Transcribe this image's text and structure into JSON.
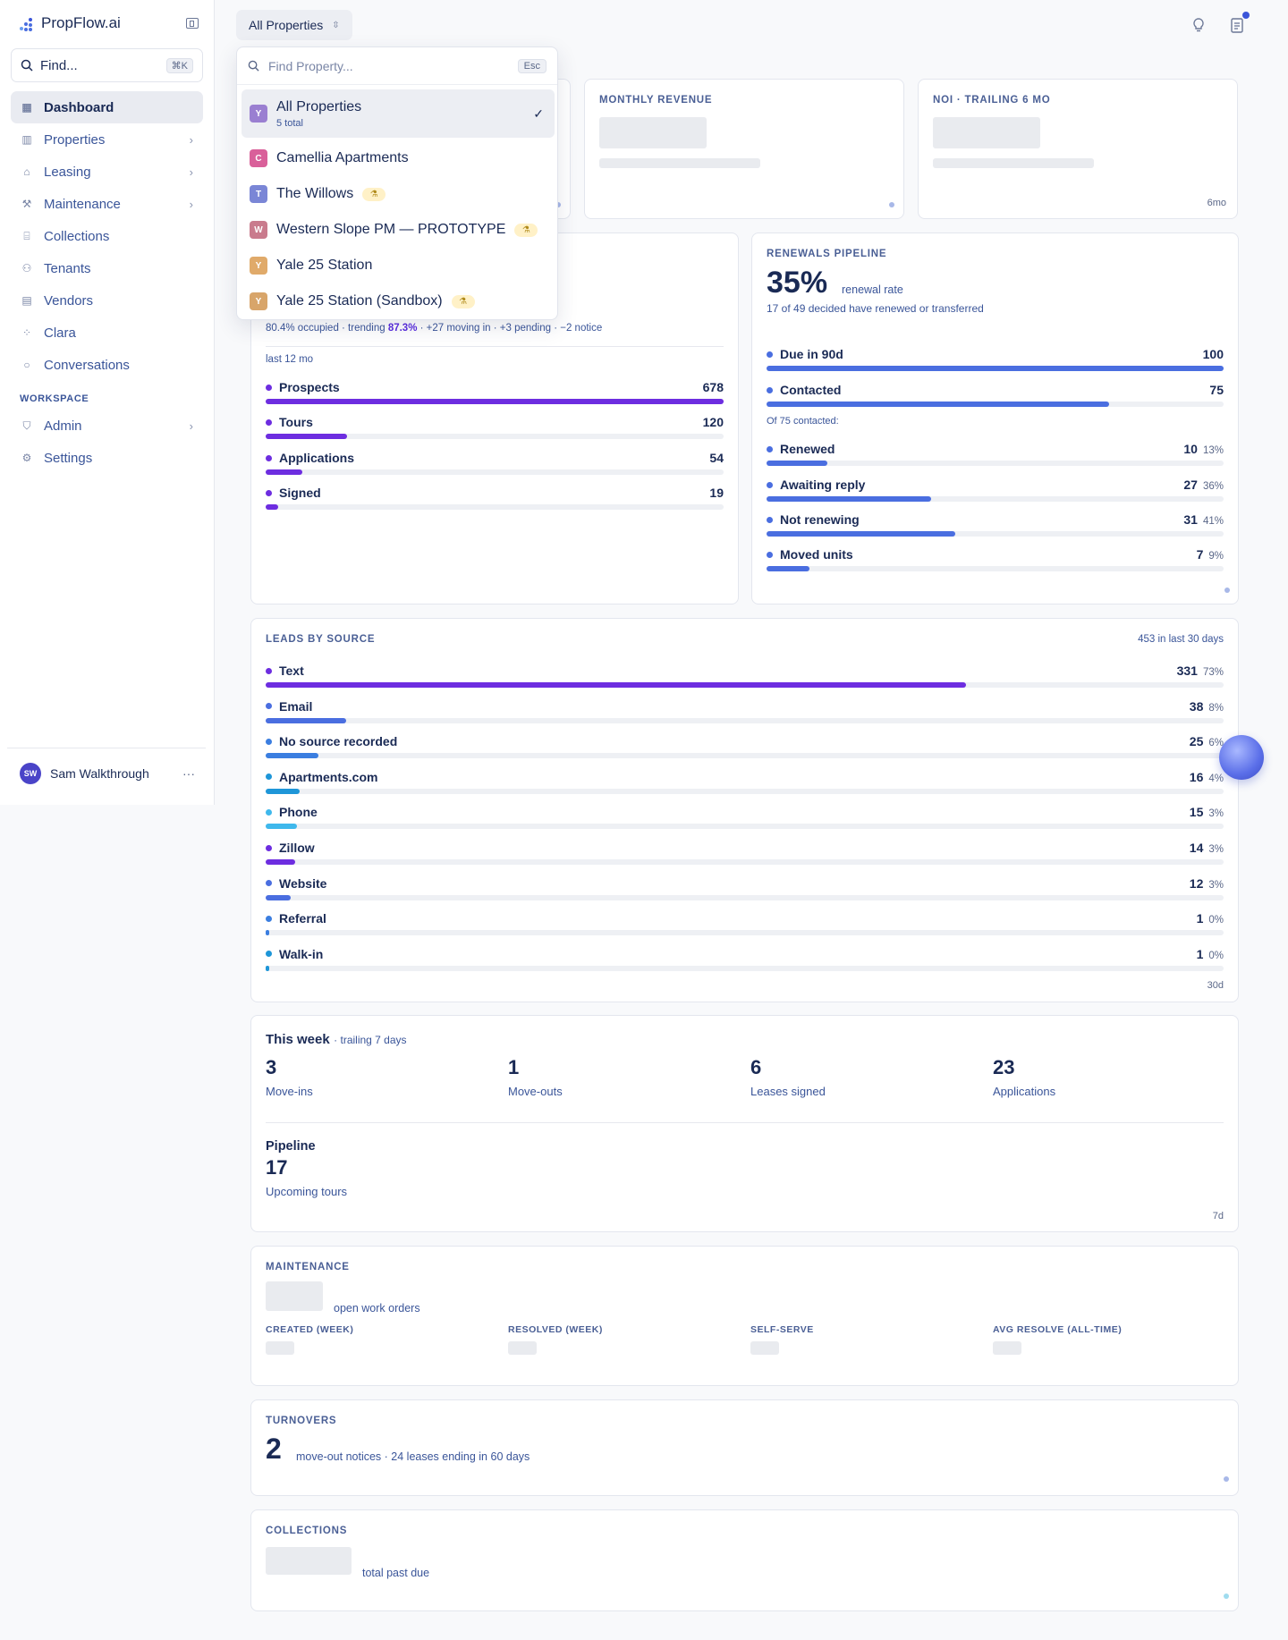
{
  "app": {
    "brand": "PropFlow.ai"
  },
  "sidebar": {
    "find_label": "Find...",
    "find_shortcut": "⌘K",
    "items": [
      {
        "label": "Dashboard",
        "icon": "grid-icon",
        "active": true
      },
      {
        "label": "Properties",
        "icon": "building-icon",
        "has_children": true
      },
      {
        "label": "Leasing",
        "icon": "home-icon",
        "has_children": true
      },
      {
        "label": "Maintenance",
        "icon": "wrench-icon",
        "has_children": true
      },
      {
        "label": "Collections",
        "icon": "bank-icon"
      },
      {
        "label": "Tenants",
        "icon": "users-icon"
      },
      {
        "label": "Vendors",
        "icon": "store-icon"
      },
      {
        "label": "Clara",
        "icon": "sparkle-dots-icon"
      },
      {
        "label": "Conversations",
        "icon": "chat-icon"
      }
    ],
    "workspace_label": "WORKSPACE",
    "workspace_items": [
      {
        "label": "Admin",
        "icon": "shield-icon",
        "has_children": true
      },
      {
        "label": "Settings",
        "icon": "gear-icon"
      }
    ],
    "user": {
      "initials": "SW",
      "name": "Sam Walkthrough",
      "more": "···"
    }
  },
  "topbar": {
    "property_select": "All Properties"
  },
  "dropdown": {
    "placeholder": "Find Property...",
    "esc": "Esc",
    "items": [
      {
        "label": "All Properties",
        "sub": "5 total",
        "initial": "Y",
        "color": "#9a7fd1",
        "selected": true
      },
      {
        "label": "Camellia Apartments",
        "initial": "C",
        "color": "#d9609a"
      },
      {
        "label": "The Willows",
        "initial": "T",
        "color": "#7a86d6",
        "beta": true
      },
      {
        "label": "Western Slope PM — PROTOTYPE",
        "initial": "W",
        "color": "#c97b8d",
        "beta": true
      },
      {
        "label": "Yale 25 Station",
        "initial": "Y",
        "color": "#e0aa6a"
      },
      {
        "label": "Yale 25 Station (Sandbox)",
        "initial": "Y",
        "color": "#d8a56a",
        "beta": true
      }
    ]
  },
  "kpis": {
    "monthly_revenue": "MONTHLY REVENUE",
    "noi": "NOI · TRAILING 6 MO",
    "noi_tag": "6mo"
  },
  "leasing": {
    "occupancy_line_a": "80.4% occupied · trending ",
    "occupancy_trend": "87.3%",
    "occupancy_line_b": " · +27 moving in · +3 pending · −2 notice",
    "period": "last 12 mo",
    "funnel": [
      {
        "label": "Prospects",
        "value": 678,
        "color": "#6d2de0"
      },
      {
        "label": "Tours",
        "value": 120,
        "color": "#6d2de0"
      },
      {
        "label": "Applications",
        "value": 54,
        "color": "#6d2de0"
      },
      {
        "label": "Signed",
        "value": 19,
        "color": "#6d2de0"
      }
    ]
  },
  "renewals": {
    "title": "RENEWALS PIPELINE",
    "rate": "35%",
    "rate_label": "renewal rate",
    "detail": "17 of 49 decided have renewed or transferred",
    "top_rows": [
      {
        "label": "Due in 90d",
        "value": 100
      },
      {
        "label": "Contacted",
        "value": 75
      }
    ],
    "contacted_label": "Of 75 contacted:",
    "breakdown": [
      {
        "label": "Renewed",
        "value": 10,
        "pct": "13%"
      },
      {
        "label": "Awaiting reply",
        "value": 27,
        "pct": "36%"
      },
      {
        "label": "Not renewing",
        "value": 31,
        "pct": "41%"
      },
      {
        "label": "Moved units",
        "value": 7,
        "pct": "9%"
      }
    ]
  },
  "leads": {
    "title": "LEADS BY SOURCE",
    "total": "453 in last 30 days",
    "tag": "30d",
    "sources": [
      {
        "label": "Text",
        "value": 331,
        "pct": "73%",
        "color": "#6d2de0"
      },
      {
        "label": "Email",
        "value": 38,
        "pct": "8%",
        "color": "#4a6ee0"
      },
      {
        "label": "No source recorded",
        "value": 25,
        "pct": "6%",
        "color": "#3b7ee0"
      },
      {
        "label": "Apartments.com",
        "value": 16,
        "pct": "4%",
        "color": "#1e96d8"
      },
      {
        "label": "Phone",
        "value": 15,
        "pct": "3%",
        "color": "#3fb8ec"
      },
      {
        "label": "Zillow",
        "value": 14,
        "pct": "3%",
        "color": "#6d2de0"
      },
      {
        "label": "Website",
        "value": 12,
        "pct": "3%",
        "color": "#4a6ee0"
      },
      {
        "label": "Referral",
        "value": 1,
        "pct": "0%",
        "color": "#3b7ee0"
      },
      {
        "label": "Walk-in",
        "value": 1,
        "pct": "0%",
        "color": "#1e96d8"
      }
    ]
  },
  "week": {
    "title": "This week",
    "subtitle": "· trailing 7 days",
    "stats": [
      {
        "value": "3",
        "label": "Move-ins"
      },
      {
        "value": "1",
        "label": "Move-outs"
      },
      {
        "value": "6",
        "label": "Leases signed"
      },
      {
        "value": "23",
        "label": "Applications"
      }
    ],
    "pipeline_title": "Pipeline",
    "pipeline_value": "17",
    "pipeline_label": "Upcoming tours",
    "tag": "7d"
  },
  "maintenance": {
    "title": "MAINTENANCE",
    "open_label": "open work orders",
    "cols": [
      "CREATED (WEEK)",
      "RESOLVED (WEEK)",
      "SELF-SERVE",
      "AVG RESOLVE (ALL-TIME)"
    ]
  },
  "turnovers": {
    "title": "TURNOVERS",
    "value": "2",
    "detail": "move-out notices · 24 leases ending in 60 days"
  },
  "collections": {
    "title": "COLLECTIONS",
    "detail": "total past due"
  }
}
